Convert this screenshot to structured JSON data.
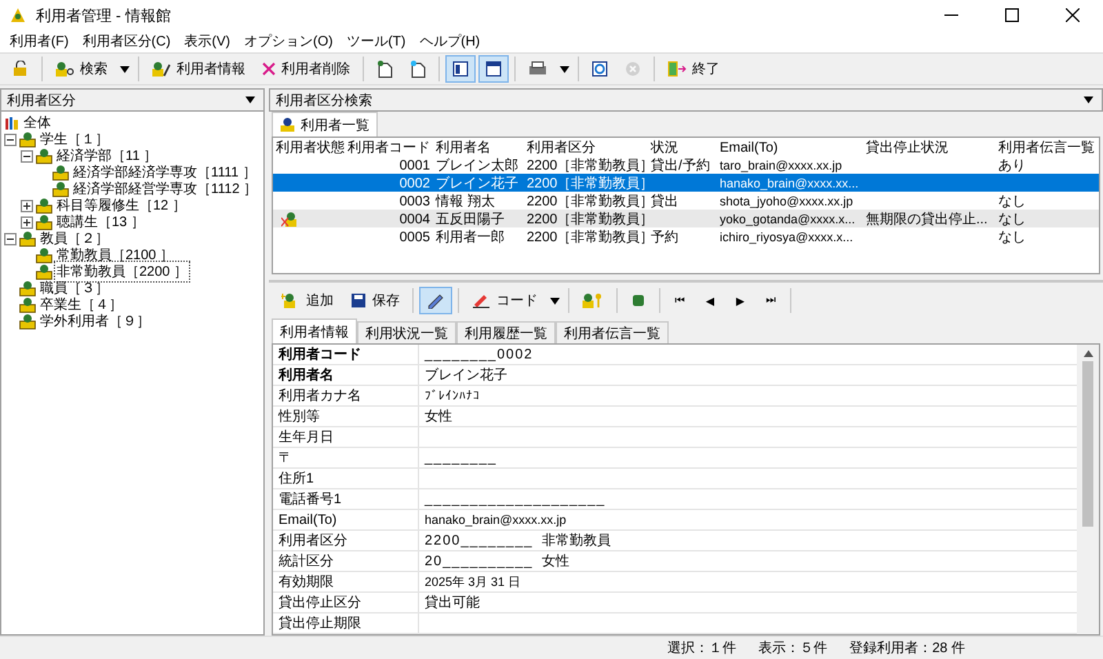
{
  "window": {
    "title": "利用者管理 - 情報館"
  },
  "menu": [
    "利用者(F)",
    "利用者区分(C)",
    "表示(V)",
    "オプション(O)",
    "ツール(T)",
    "ヘルプ(H)"
  ],
  "toolbar": [
    {
      "kind": "icon",
      "pressed": false,
      "disabled": false
    },
    {
      "kind": "separator"
    },
    {
      "kind": "labeled",
      "label": "検索",
      "pressed": false,
      "disabled": false
    },
    {
      "kind": "dropdown"
    },
    {
      "kind": "separator"
    },
    {
      "kind": "labeled",
      "label": "利用者情報",
      "pressed": false,
      "disabled": false
    },
    {
      "kind": "labeled",
      "label": "利用者削除",
      "pressed": false,
      "disabled": false
    },
    {
      "kind": "separator"
    },
    {
      "kind": "icon",
      "pressed": false,
      "disabled": false
    },
    {
      "kind": "icon",
      "pressed": false,
      "disabled": false
    },
    {
      "kind": "separator"
    },
    {
      "kind": "icon",
      "pressed": true,
      "disabled": false
    },
    {
      "kind": "icon",
      "pressed": true,
      "disabled": false
    },
    {
      "kind": "separator"
    },
    {
      "kind": "icon",
      "pressed": false,
      "disabled": false
    },
    {
      "kind": "dropdown"
    },
    {
      "kind": "separator"
    },
    {
      "kind": "icon",
      "pressed": false,
      "disabled": false
    },
    {
      "kind": "icon",
      "pressed": false,
      "disabled": true
    },
    {
      "kind": "separator"
    },
    {
      "kind": "labeled",
      "label": "終了",
      "pressed": false,
      "disabled": false
    }
  ],
  "left_panel": {
    "title": "利用者区分",
    "tree": [
      {
        "label": "全体",
        "kind": "root",
        "selected": false
      },
      {
        "label": "学生［１］",
        "kind": "node",
        "expanded": true,
        "selected": false,
        "children": [
          {
            "label": "経済学部［11 ］",
            "kind": "node",
            "expanded": true,
            "selected": false,
            "children": [
              {
                "label": "経済学部経済学専攻［1111 ］",
                "kind": "node",
                "selected": false
              },
              {
                "label": "経済学部経営学専攻［1112 ］",
                "kind": "node",
                "selected": false
              }
            ]
          },
          {
            "label": "科目等履修生［12 ］",
            "kind": "node",
            "expanded": false,
            "selected": false
          },
          {
            "label": "聴講生［13 ］",
            "kind": "node",
            "expanded": false,
            "selected": false
          }
        ]
      },
      {
        "label": "教員［２］",
        "kind": "node",
        "expanded": true,
        "selected": false,
        "children": [
          {
            "label": "常勤教員［2100 ］",
            "kind": "node",
            "selected": false
          },
          {
            "label": "非常勤教員［2200 ］",
            "kind": "node",
            "selected": true
          }
        ]
      },
      {
        "label": "職員［３］",
        "kind": "node",
        "selected": false
      },
      {
        "label": "卒業生［４］",
        "kind": "node",
        "selected": false
      },
      {
        "label": "学外利用者［９］",
        "kind": "node",
        "selected": false
      }
    ]
  },
  "right_panel": {
    "title": "利用者区分検索",
    "tab": "利用者一覧",
    "table": {
      "columns": [
        "利用者状態",
        "利用者コード",
        "利用者名",
        "利用者区分",
        "状況",
        "Email(To)",
        "貸出停止状況",
        "利用者伝言一覧"
      ],
      "rows": [
        {
          "cells": [
            "",
            "0001",
            "ブレイン太郎",
            "2200［非常勤教員］",
            "貸出/予約",
            "taro_brain@xxxx.xx.jp",
            "",
            "あり"
          ],
          "selected": false,
          "highlighted": false,
          "suspended": false
        },
        {
          "cells": [
            "",
            "0002",
            "ブレイン花子",
            "2200［非常勤教員］",
            "",
            "hanako_brain@xxxx.xx...",
            "",
            ""
          ],
          "selected": true,
          "highlighted": false,
          "suspended": false
        },
        {
          "cells": [
            "",
            "0003",
            "情報 翔太",
            "2200［非常勤教員］",
            "貸出",
            "shota_jyoho@xxxx.xx.jp",
            "",
            "なし"
          ],
          "selected": false,
          "highlighted": false,
          "suspended": false
        },
        {
          "cells": [
            "",
            "0004",
            "五反田陽子",
            "2200［非常勤教員］",
            "",
            "yoko_gotanda@xxxx.x...",
            "無期限の貸出停止...",
            "なし"
          ],
          "selected": false,
          "highlighted": true,
          "suspended": true
        },
        {
          "cells": [
            "",
            "0005",
            "利用者一郎",
            "2200［非常勤教員］",
            "予約",
            "ichiro_riyosya@xxxx.x...",
            "",
            "なし"
          ],
          "selected": false,
          "highlighted": false,
          "suspended": false
        }
      ]
    }
  },
  "detail_toolbar": [
    {
      "kind": "labeled",
      "label": "追加",
      "pressed": false
    },
    {
      "kind": "labeled",
      "label": "保存",
      "pressed": false
    },
    {
      "kind": "separator"
    },
    {
      "kind": "icon",
      "pressed": true
    },
    {
      "kind": "separator"
    },
    {
      "kind": "labeled",
      "label": "コード",
      "pressed": false
    },
    {
      "kind": "dropdown"
    },
    {
      "kind": "separator"
    },
    {
      "kind": "icon",
      "pressed": false
    },
    {
      "kind": "separator"
    },
    {
      "kind": "icon",
      "pressed": false
    },
    {
      "kind": "separator"
    },
    {
      "kind": "nav",
      "label": "⏮"
    },
    {
      "kind": "nav",
      "label": "◀"
    },
    {
      "kind": "nav",
      "label": "▶"
    },
    {
      "kind": "nav",
      "label": "⏭"
    },
    {
      "kind": "separator"
    }
  ],
  "detail_tabs": [
    {
      "label": "利用者情報",
      "selected": true
    },
    {
      "label": "利用状況一覧",
      "selected": false
    },
    {
      "label": "利用履歴一覧",
      "selected": false
    },
    {
      "label": "利用者伝言一覧",
      "selected": false
    }
  ],
  "fields": [
    {
      "label": "利用者コード",
      "required": true,
      "kind": "code",
      "value": "________0002"
    },
    {
      "label": "利用者名",
      "required": true,
      "kind": "text",
      "value": "ブレイン花子"
    },
    {
      "label": "利用者カナ名",
      "required": false,
      "kind": "small",
      "value": "ﾌﾞﾚｲﾝﾊﾅｺ"
    },
    {
      "label": "性別等",
      "required": false,
      "kind": "text",
      "value": "女性"
    },
    {
      "label": "生年月日",
      "required": false
    },
    {
      "label": "〒",
      "required": false,
      "kind": "code",
      "value": "________"
    },
    {
      "label": "住所1",
      "required": false
    },
    {
      "label": "電話番号1",
      "required": false,
      "kind": "code",
      "value": "____________________"
    },
    {
      "label": "Email(To)",
      "required": false,
      "kind": "small",
      "value": "hanako_brain@xxxx.xx.jp"
    },
    {
      "label": "利用者区分",
      "required": false,
      "kind": "code",
      "value": "2200________",
      "suffix": "非常勤教員"
    },
    {
      "label": "統計区分",
      "required": false,
      "kind": "code",
      "value": "20__________",
      "suffix": "女性"
    },
    {
      "label": "有効期限",
      "required": false,
      "kind": "small",
      "value": "2025年 3月 31 日"
    },
    {
      "label": "貸出停止区分",
      "required": false,
      "kind": "text",
      "value": "貸出可能"
    },
    {
      "label": "貸出停止期限",
      "required": false
    }
  ],
  "status_bar": [
    "選択：１件",
    "表示：５件",
    "登録利用者：28 件"
  ]
}
